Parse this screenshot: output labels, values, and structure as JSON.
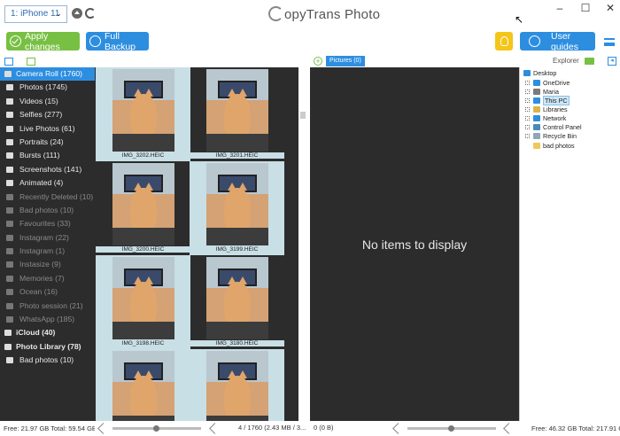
{
  "titlebar": {
    "device": "1: iPhone 11",
    "app_title": "CopyTrans Photo",
    "app_title_rest": "opyTrans Photo"
  },
  "toolbar": {
    "apply_label": "Apply changes",
    "backup_label": "Full Backup",
    "guides_label": "User guides"
  },
  "sidebar": {
    "items": [
      {
        "label": "Camera Roll (1760)",
        "icon": "camera-icon",
        "state": "selected"
      },
      {
        "label": "Photos (1745)",
        "icon": "camera-icon",
        "state": "normal"
      },
      {
        "label": "Videos (15)",
        "icon": "video-icon",
        "state": "normal"
      },
      {
        "label": "Selfies (277)",
        "icon": "selfie-icon",
        "state": "normal"
      },
      {
        "label": "Live Photos (61)",
        "icon": "live-photo-icon",
        "state": "normal"
      },
      {
        "label": "Portraits (24)",
        "icon": "portrait-icon",
        "state": "normal"
      },
      {
        "label": "Bursts (111)",
        "icon": "burst-icon",
        "state": "normal"
      },
      {
        "label": "Screenshots (141)",
        "icon": "screenshot-icon",
        "state": "normal"
      },
      {
        "label": "Animated (4)",
        "icon": "animated-icon",
        "state": "normal"
      },
      {
        "label": "Recently Deleted (10)",
        "icon": "trash-icon",
        "state": "dim"
      },
      {
        "label": "Bad photos (10)",
        "icon": "album-icon",
        "state": "dim"
      },
      {
        "label": "Favourites (33)",
        "icon": "album-icon",
        "state": "dim"
      },
      {
        "label": "Instagram (22)",
        "icon": "album-icon",
        "state": "dim"
      },
      {
        "label": "Instagram (1)",
        "icon": "album-icon",
        "state": "dim"
      },
      {
        "label": "Instasize (9)",
        "icon": "album-icon",
        "state": "dim"
      },
      {
        "label": "Memories (7)",
        "icon": "album-icon",
        "state": "dim"
      },
      {
        "label": "Ocean (16)",
        "icon": "album-icon",
        "state": "dim"
      },
      {
        "label": "Photo session (21)",
        "icon": "album-icon",
        "state": "dim"
      },
      {
        "label": "WhatsApp (185)",
        "icon": "album-icon",
        "state": "dim"
      },
      {
        "label": "iCloud (40)",
        "icon": "cloud-icon",
        "state": "section"
      },
      {
        "label": "Photo Library (78)",
        "icon": "camera-icon",
        "state": "section"
      },
      {
        "label": "Bad photos (10)",
        "icon": "album-icon",
        "state": "normal"
      }
    ],
    "footer": "Free: 21.97 GB Total: 59.54 GB"
  },
  "grid": {
    "photos": [
      {
        "name": "IMG_3202.HEIC",
        "selected": true
      },
      {
        "name": "IMG_3201.HEIC",
        "selected": false
      },
      {
        "name": "IMG_3200.HEIC",
        "selected": false
      },
      {
        "name": "IMG_3199.HEIC",
        "selected": true
      },
      {
        "name": "IMG_3198.HEIC",
        "selected": true
      },
      {
        "name": "IMG_3180.HEIC",
        "selected": false
      },
      {
        "name": "",
        "selected": true
      },
      {
        "name": "",
        "selected": true
      }
    ],
    "status": "4 / 1760 (2.43 MB / 3..."
  },
  "pictures": {
    "tab_label": "Pictures (0)",
    "empty_message": "No items to display",
    "status": "0 (0 B)"
  },
  "explorer": {
    "label": "Explorer",
    "items": [
      {
        "label": "Desktop",
        "icon": "desktop-icon",
        "color": "#2d8ee0"
      },
      {
        "label": "OneDrive",
        "icon": "onedrive-icon",
        "color": "#2d8ee0"
      },
      {
        "label": "Maria",
        "icon": "user-icon",
        "color": "#7a7a7a"
      },
      {
        "label": "This PC",
        "icon": "computer-icon",
        "color": "#2d8ee0",
        "highlight": true
      },
      {
        "label": "Libraries",
        "icon": "libraries-icon",
        "color": "#d9b54a"
      },
      {
        "label": "Network",
        "icon": "network-icon",
        "color": "#2d8ee0"
      },
      {
        "label": "Control Panel",
        "icon": "control-panel-icon",
        "color": "#4a8ab5"
      },
      {
        "label": "Recycle Bin",
        "icon": "recycle-bin-icon",
        "color": "#8fa7b8"
      },
      {
        "label": "bad photos",
        "icon": "folder-icon",
        "color": "#f0c75e"
      }
    ],
    "footer": "Free: 46.32 GB Total: 217.91 GB"
  },
  "colors": {
    "accent_blue": "#2d8ee0",
    "accent_green": "#78c043",
    "accent_yellow": "#f5c518",
    "panel_dark": "#2c2c2c"
  }
}
